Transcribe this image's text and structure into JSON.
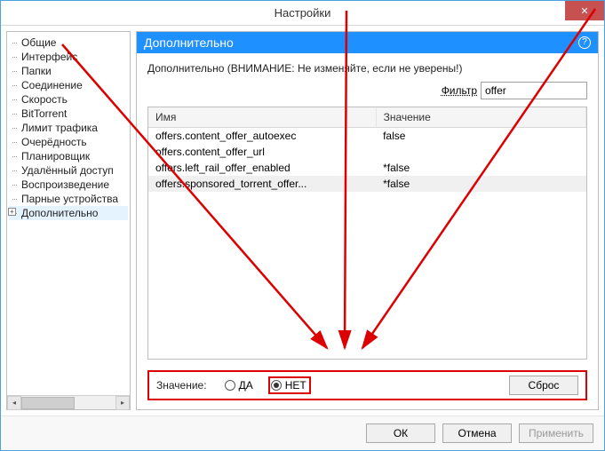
{
  "window": {
    "title": "Настройки"
  },
  "sidebar": {
    "items": [
      "Общие",
      "Интерфейс",
      "Папки",
      "Соединение",
      "Скорость",
      "BitTorrent",
      "Лимит трафика",
      "Очерёдность",
      "Планировщик",
      "Удалённый доступ",
      "Воспроизведение",
      "Парные устройства",
      "Дополнительно"
    ],
    "selected_index": 12,
    "expandable_index": 12
  },
  "panel": {
    "title": "Дополнительно",
    "warning": "Дополнительно (ВНИМАНИЕ: Не изменяйте, если не уверены!)",
    "filter_label": "Фильтр",
    "filter_value": "offer",
    "columns": [
      "Имя",
      "Значение"
    ],
    "rows": [
      {
        "name": "offers.content_offer_autoexec",
        "value": "false"
      },
      {
        "name": "offers.content_offer_url",
        "value": ""
      },
      {
        "name": "offers.left_rail_offer_enabled",
        "value": "*false"
      },
      {
        "name": "offers.sponsored_torrent_offer...",
        "value": "*false"
      }
    ],
    "selected_row": 3,
    "value_label": "Значение:",
    "radio_yes": "ДА",
    "radio_no": "НЕТ",
    "radio_selected": "no",
    "reset_label": "Сброс"
  },
  "footer": {
    "ok": "ОК",
    "cancel": "Отмена",
    "apply": "Применить",
    "apply_enabled": false
  }
}
